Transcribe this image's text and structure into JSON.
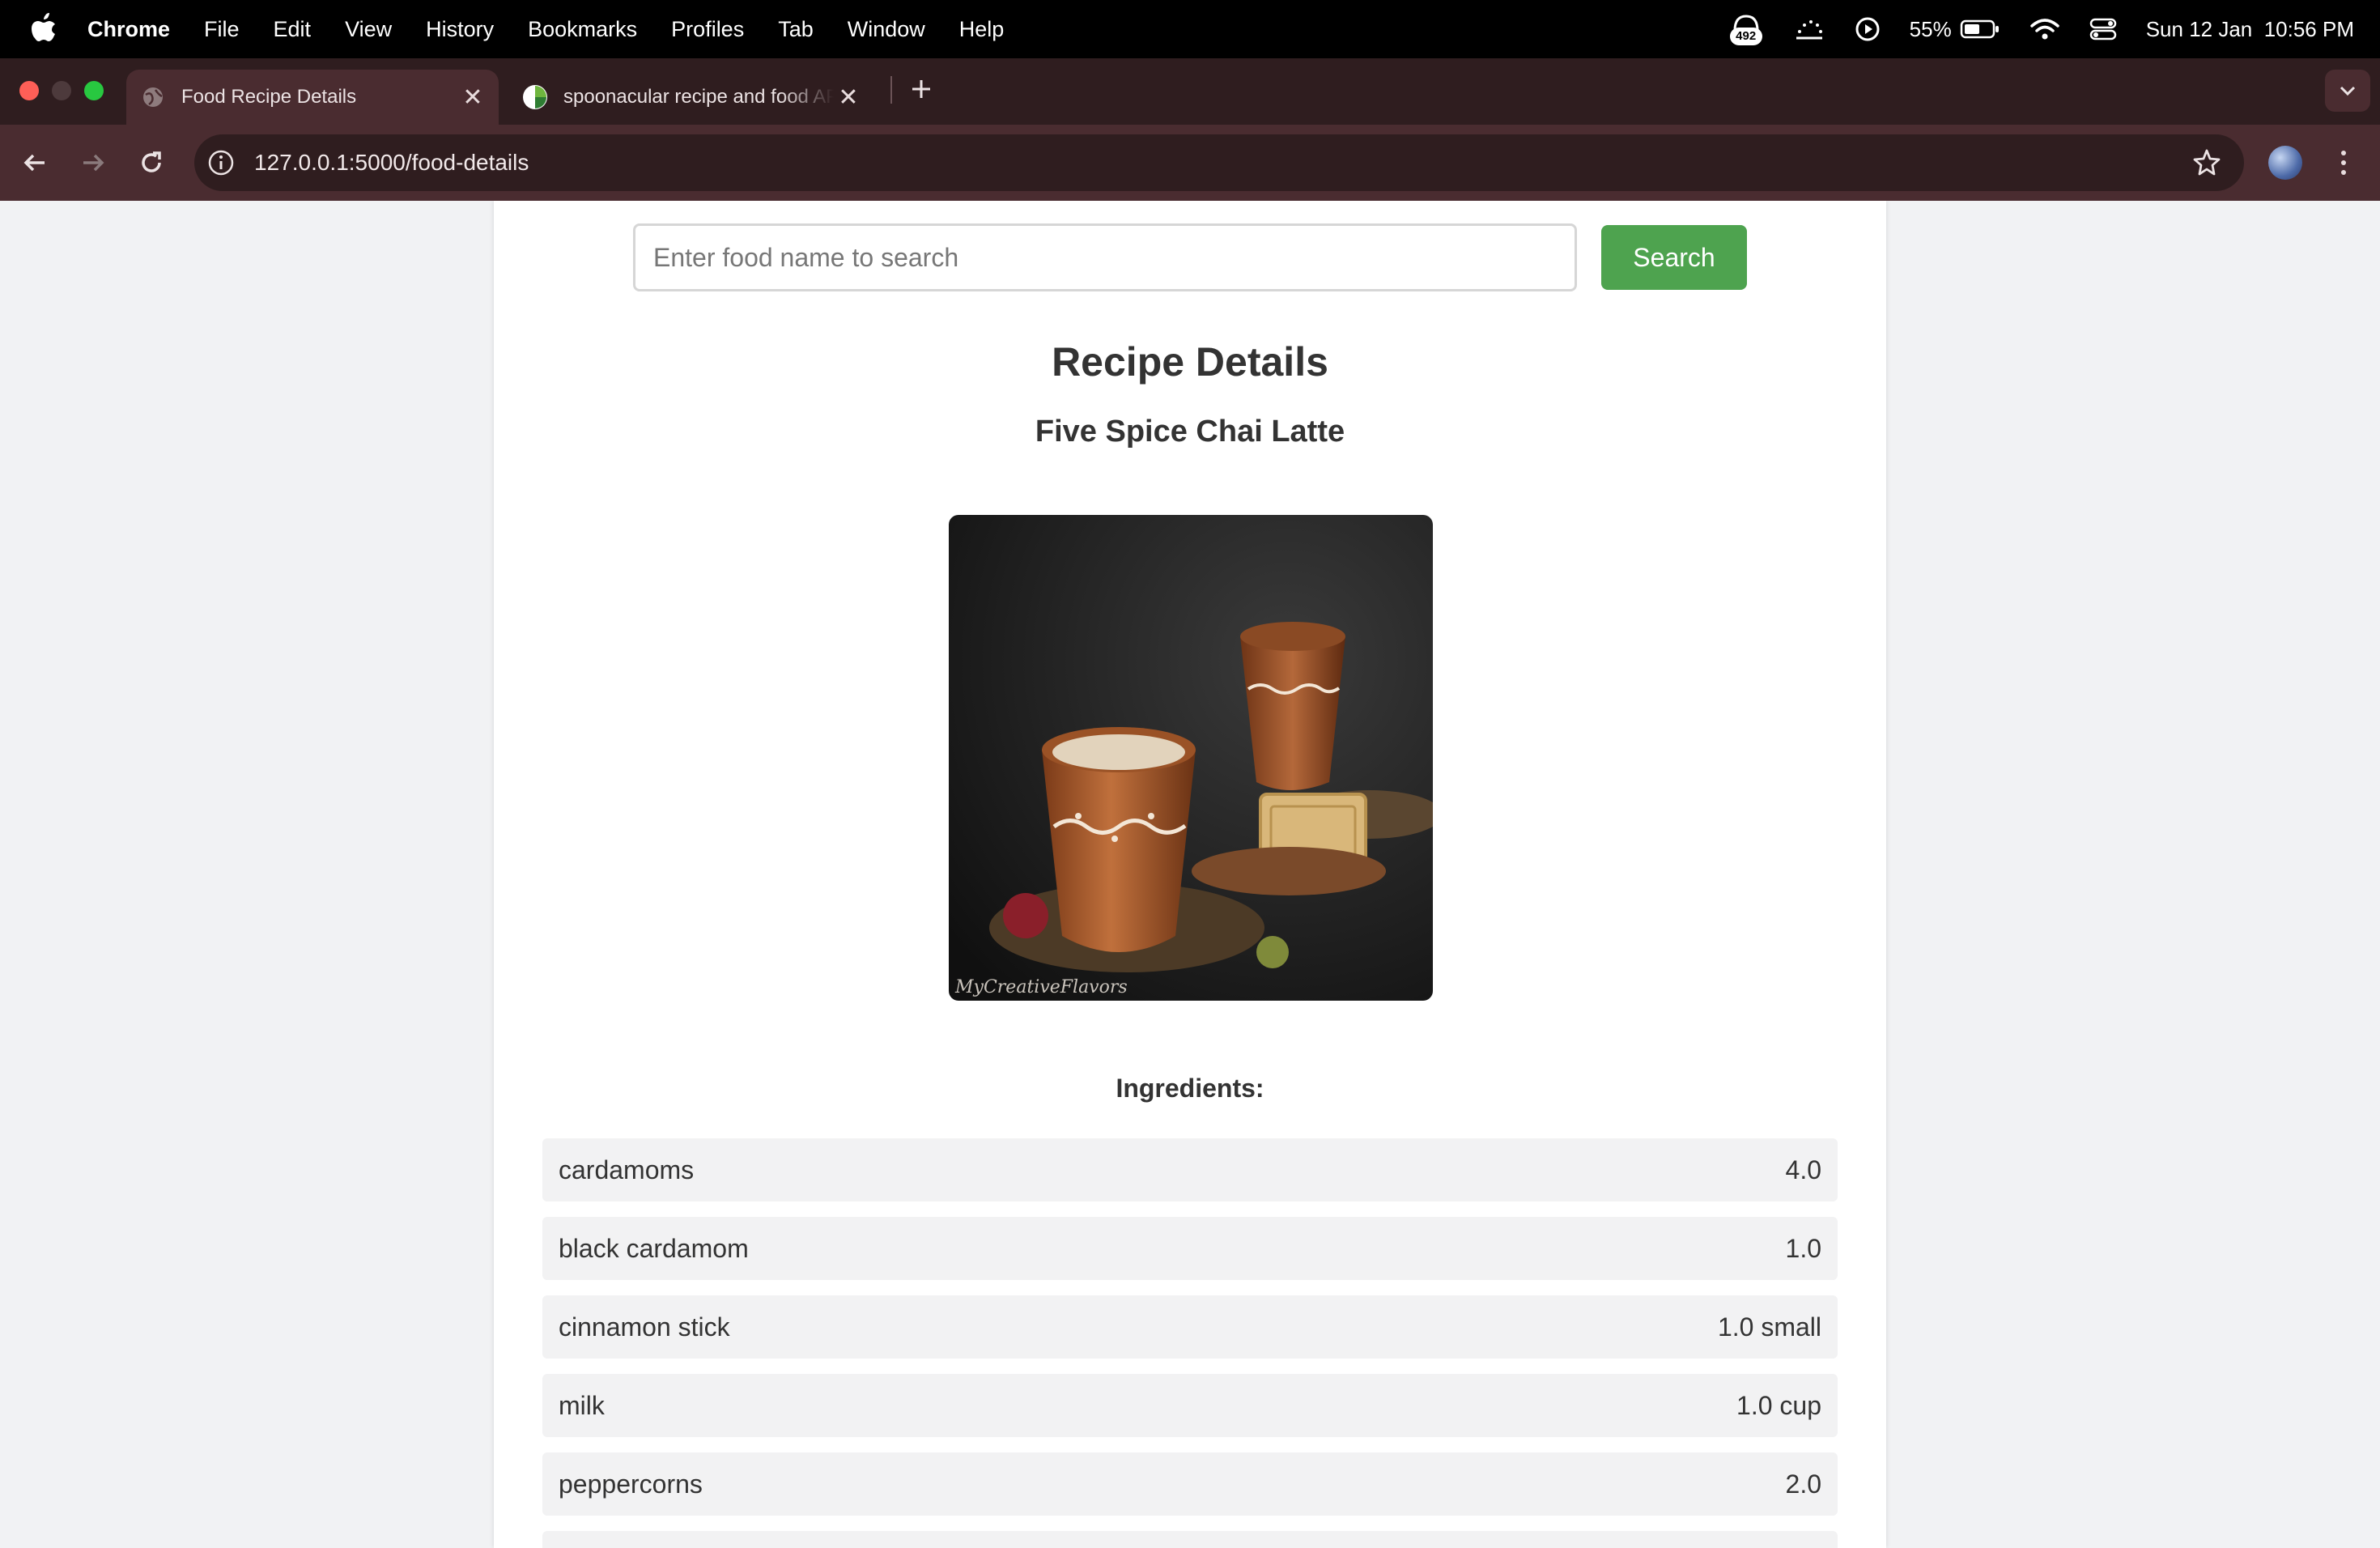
{
  "menubar": {
    "app_name": "Chrome",
    "items": [
      "File",
      "Edit",
      "View",
      "History",
      "Bookmarks",
      "Profiles",
      "Tab",
      "Window",
      "Help"
    ],
    "badge_count": "492",
    "battery": "55%",
    "datetime": "Sun 12 Jan  10:56 PM"
  },
  "tabs": [
    {
      "title": "Food Recipe Details",
      "active": true
    },
    {
      "title": "spoonacular recipe and food API",
      "active": false
    }
  ],
  "toolbar": {
    "url": "127.0.0.1:5000/food-details"
  },
  "search": {
    "placeholder": "Enter food name to search",
    "button_label": "Search"
  },
  "page": {
    "title": "Recipe Details",
    "recipe_name": "Five Spice Chai Latte",
    "ingredients_heading": "Ingredients:",
    "image_watermark": "MyCreativeFlavors"
  },
  "ingredients": [
    {
      "name": "cardamoms",
      "amount": "4.0"
    },
    {
      "name": "black cardamom",
      "amount": "1.0"
    },
    {
      "name": "cinnamon stick",
      "amount": "1.0 small"
    },
    {
      "name": "milk",
      "amount": "1.0 cup"
    },
    {
      "name": "peppercorns",
      "amount": "2.0"
    }
  ],
  "colors": {
    "accent": "#4ea34f",
    "tab_strip": "#2f1d1f",
    "toolbar": "#4a2c30",
    "page_bg": "#f1f2f4"
  }
}
